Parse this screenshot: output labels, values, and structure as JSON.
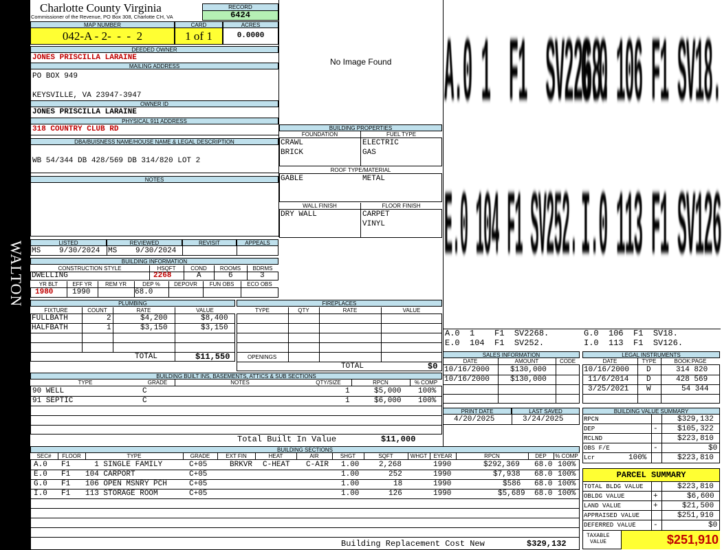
{
  "side_label": "WALTON",
  "header": {
    "county": "Charlotte County Virginia",
    "commissioner": "Commissioner of the Revenue, PO Box 308, Charlotte CH, VA",
    "record_label": "RECORD",
    "record": "6424",
    "map_number_label": "MAP NUMBER",
    "map_number": "042-A - 2-  -  -  2",
    "card_label": "CARD",
    "card": "1 of 1",
    "acres_label": "ACRES",
    "acres": "0.0000"
  },
  "owner": {
    "deeded_owner_label": "DEEDED OWNER",
    "deeded_owner": "JONES PRISCILLA LARAINE",
    "mailing_label": "MAILING ADDRESS",
    "mailing_line1": "PO BOX 949",
    "mailing_line2": "KEYSVILLE, VA 23947-3947",
    "owner_id_label": "OWNER ID",
    "owner_id": "JONES PRISCILLA LARAINE",
    "address_911_label": "PHYSICAL 911 ADDRESS",
    "address_911": "318 COUNTRY CLUB RD",
    "legal_label": "DBA/BUISNESS NAME/HOUSE NAME & LEGAL DESCRIPTION",
    "legal": "WB 54/344 DB 428/569 DB 314/820 LOT 2",
    "notes_label": "NOTES"
  },
  "image_placeholder": "No Image Found",
  "building_properties": {
    "title": "BUILDING PROPERTIES",
    "foundation_label": "FOUNDATION",
    "fuel_label": "FUEL TYPE",
    "foundation_1": "CRAWL",
    "foundation_2": "BRICK",
    "fuel_1": "ELECTRIC",
    "fuel_2": "GAS",
    "roof_label": "ROOF TYPE/MATERIAL",
    "roof_type": "GABLE",
    "roof_material": "METAL",
    "wall_label": "WALL FINISH",
    "floor_label": "FLOOR FINISH",
    "wall_1": "DRY WALL",
    "floor_1": "CARPET",
    "floor_2": "VINYL"
  },
  "sketch": {
    "row1_left": "A.0 1  F1  SV2268.",
    "row1_right": "G.0 106 F1 SV18.",
    "row2_left": "E.0 104 F1 SV252.",
    "row2_right": "I.0 113 F1 SV126.",
    "key_1": "A.0  1    F1  SV2268.",
    "key_2": "G.0  106  F1  SV18.",
    "key_3": "E.0  104  F1  SV252.",
    "key_4": "I.0  113  F1  SV126."
  },
  "listing": {
    "listed_label": "LISTED",
    "reviewed_label": "REVIEWED",
    "revisit_label": "REVISIT",
    "appeals_label": "APPEALS",
    "listed_by": "MS",
    "listed_date": "9/30/2024",
    "reviewed_by": "MS",
    "reviewed_date": "9/30/2024"
  },
  "building_info": {
    "title": "BUILDING INFORMATION",
    "style_label": "CONSTRUCTION STYLE",
    "hsqft_label": "HSQFT",
    "cond_label": "COND",
    "rooms_label": "ROOMS",
    "bdrms_label": "BDRMS",
    "style": "DWELLING",
    "hsqft": "2268",
    "cond": "A",
    "rooms": "6",
    "bdrms": "3",
    "yrblt_label": "YR BLT",
    "effyr_label": "EFF YR",
    "remyr_label": "REM YR",
    "dep_label": "DEP %",
    "depovr_label": "DEPOVR",
    "funobs_label": "FUN OBS",
    "ecoobs_label": "ECO OBS",
    "yrblt": "1980",
    "effyr": "1990",
    "dep": "68.0"
  },
  "plumbing": {
    "title": "PLUMBING",
    "columns": [
      "FIXTURE",
      "COUNT",
      "RATE",
      "VALUE"
    ],
    "rows": [
      {
        "fixture": "FULLBATH",
        "count": "2",
        "rate": "$4,200",
        "value": "$8,400"
      },
      {
        "fixture": "HALFBATH",
        "count": "1",
        "rate": "$3,150",
        "value": "$3,150"
      }
    ],
    "total_label": "TOTAL",
    "total": "$11,550"
  },
  "fireplaces": {
    "title": "FIREPLACES",
    "columns": [
      "TYPE",
      "QTY",
      "RATE",
      "VALUE"
    ],
    "openings_label": "OPENINGS",
    "total_label": "TOTAL",
    "total": "$0"
  },
  "sales": {
    "title": "SALES INFORMATION",
    "columns": [
      "DATE",
      "AMOUNT",
      "CODE"
    ],
    "rows": [
      {
        "date": "10/16/2000",
        "amount": "$130,000",
        "code": ""
      },
      {
        "date": "10/16/2000",
        "amount": "$130,000",
        "code": ""
      }
    ]
  },
  "legal_instruments": {
    "title": "LEGAL INSTRUMENTS",
    "columns": [
      "DATE",
      "TYPE",
      "BOOK:PAGE"
    ],
    "rows": [
      {
        "date": "10/16/2000",
        "type": "D",
        "book": "314 820"
      },
      {
        "date": "11/6/2014",
        "type": "D",
        "book": "428 569"
      },
      {
        "date": "3/25/2021",
        "type": "W",
        "book": "54 344"
      }
    ]
  },
  "dates": {
    "print_label": "PRINT DATE",
    "saved_label": "LAST SAVED",
    "print_date": "4/20/2025",
    "saved_date": "3/24/2025"
  },
  "bvs": {
    "title": "BUILDING VALUE SUMMARY",
    "rpcn_label": "RPCN",
    "rpcn": "$329,132",
    "dep_label": "DEP",
    "dep_sign": "-",
    "dep": "$105,322",
    "rclnd_label": "RCLND",
    "rclnd": "$223,810",
    "obs_label": "OBS F/E",
    "obs_sign": "-",
    "obs": "$0",
    "lcr_label": "Lcr",
    "lcr_pct": "100%",
    "lcr": "$223,810"
  },
  "parcel": {
    "title": "PARCEL SUMMARY",
    "total_bldg_label": "TOTAL BLDG VALUE",
    "total_bldg": "$223,810",
    "obldg_label": "OBLDG VALUE",
    "obldg_sign": "+",
    "obldg": "$6,600",
    "land_label": "LAND VALUE",
    "land_sign": "+",
    "land": "$21,500",
    "appraised_label": "APPRAISED VALUE",
    "appraised": "$251,910",
    "deferred_label": "DEFERRED VALUE",
    "deferred_sign": "-",
    "deferred": "$0",
    "taxable_label_1": "TAXABLE",
    "taxable_label_2": "VALUE",
    "taxable": "$251,910"
  },
  "built_ins": {
    "title": "BUILDING BUILT INS, BASEMENTS, ATTICS & SUB SECTIONS",
    "columns": [
      "TYPE",
      "GRADE",
      "NOTES",
      "QTY/SIZE",
      "RPCN",
      "% COMP"
    ],
    "rows": [
      {
        "type": "90 WELL",
        "grade": "C",
        "notes": "",
        "qty": "1",
        "rpcn": "$5,000",
        "comp": "100%"
      },
      {
        "type": "91 SEPTIC",
        "grade": "C",
        "notes": "",
        "qty": "1",
        "rpcn": "$6,000",
        "comp": "100%"
      }
    ],
    "total_label": "Total Built In Value",
    "total": "$11,000"
  },
  "sections": {
    "title": "BUILDING SECTIONS",
    "columns": [
      "SEC#",
      "FLOOR",
      "TYPE",
      "GRADE",
      "EXT FIN",
      "HEAT",
      "AIR",
      "SHGT",
      "SQFT",
      "WHGT",
      "EYEAR",
      "RPCN",
      "DEP",
      "% COMP"
    ],
    "rows": [
      {
        "sec": "A.0",
        "floor": "F1",
        "type": "  1 SINGLE FAMILY",
        "grade": "C+05",
        "ext": "BRKVR",
        "heat": "C-HEAT",
        "air": "C-AIR",
        "shgt": "1.00",
        "sqft": "2,268",
        "whgt": "",
        "eyear": "1990",
        "rpcn": "$292,369",
        "dep": "68.0",
        "comp": "100%"
      },
      {
        "sec": "E.0",
        "floor": "F1",
        "type": "104 CARPORT",
        "grade": "C+05",
        "ext": "",
        "heat": "",
        "air": "",
        "shgt": "1.00",
        "sqft": "252",
        "whgt": "",
        "eyear": "1990",
        "rpcn": "$7,938",
        "dep": "68.0",
        "comp": "100%"
      },
      {
        "sec": "G.0",
        "floor": "F1",
        "type": "106 OPEN MSNRY PCH",
        "grade": "C+05",
        "ext": "",
        "heat": "",
        "air": "",
        "shgt": "1.00",
        "sqft": "18",
        "whgt": "",
        "eyear": "1990",
        "rpcn": "$586",
        "dep": "68.0",
        "comp": "100%"
      },
      {
        "sec": "I.0",
        "floor": "F1",
        "type": "113 STORAGE ROOM",
        "grade": "C+05",
        "ext": "",
        "heat": "",
        "air": "",
        "shgt": "1.00",
        "sqft": "126",
        "whgt": "",
        "eyear": "1990",
        "rpcn": "$5,689",
        "dep": "68.0",
        "comp": "100%"
      }
    ],
    "total_label": "Building Replacement Cost New",
    "total": "$329,132"
  }
}
